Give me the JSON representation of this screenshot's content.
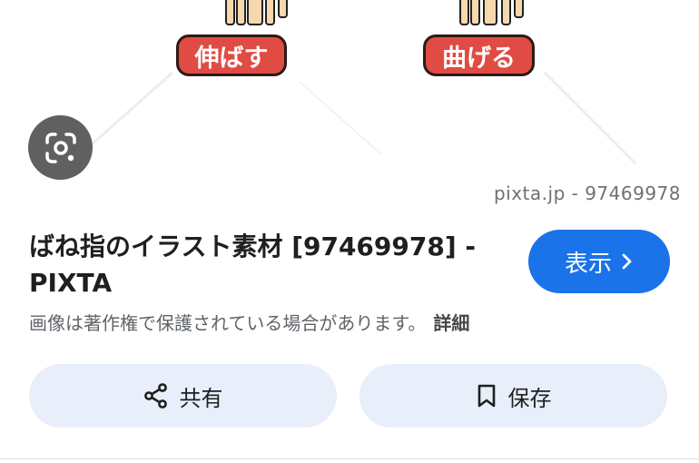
{
  "preview": {
    "labels": [
      "伸ばす",
      "曲げる"
    ],
    "watermark": "pixta.jp - 97469978"
  },
  "icons": {
    "lens": "google-lens-icon",
    "chevron": "chevron-right-icon",
    "share": "share-icon",
    "bookmark": "bookmark-icon"
  },
  "result": {
    "title_line1": "ばね指のイラスト素材 [97469978] -",
    "title_line2": "PIXTA",
    "show_label": "表示",
    "notice": "画像は著作権で保護されている場合があります。",
    "details_link": "詳細"
  },
  "actions": {
    "share_label": "共有",
    "save_label": "保存"
  },
  "colors": {
    "accent": "#1a73e8",
    "action_bg": "#e8effa",
    "label_red": "#e04b43"
  }
}
